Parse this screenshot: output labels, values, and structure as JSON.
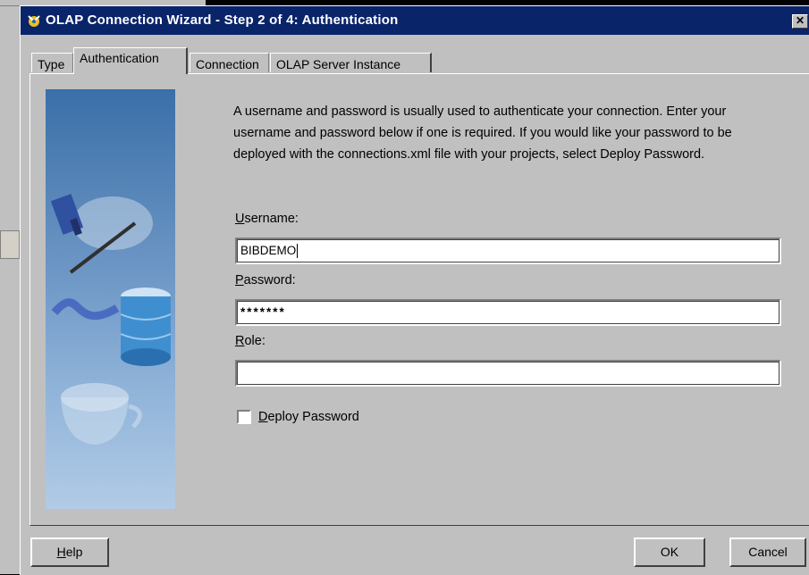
{
  "window": {
    "title": "OLAP Connection Wizard - Step 2 of 4: Authentication",
    "close_glyph": "✕",
    "icon": "wizard-icon"
  },
  "tabs": [
    {
      "label": "Type"
    },
    {
      "label": "Authentication",
      "selected": true
    },
    {
      "label": "Connection"
    },
    {
      "label": "OLAP Server Instance"
    }
  ],
  "panel": {
    "description": "A username and password is usually used to authenticate your connection.  Enter your username and password below if one is required.  If you would like your password to be deployed with the connections.xml file with your projects, select Deploy Password.",
    "username": {
      "mnemonic": "U",
      "label_rest": "sername:",
      "value": "BIBDEMO"
    },
    "password": {
      "mnemonic": "P",
      "label_rest": "assword:",
      "value": "*******"
    },
    "role": {
      "mnemonic": "R",
      "label_rest": "ole:",
      "value": ""
    },
    "deploy": {
      "mnemonic": "D",
      "label_rest": "eploy Password",
      "checked": false
    }
  },
  "buttons": {
    "help": {
      "mnemonic": "H",
      "label_rest": "elp"
    },
    "ok": "OK",
    "cancel": "Cancel"
  },
  "colors": {
    "titlebar": "#0a246a",
    "face": "#c0c0c0",
    "art_top": "#3a6fa8"
  }
}
